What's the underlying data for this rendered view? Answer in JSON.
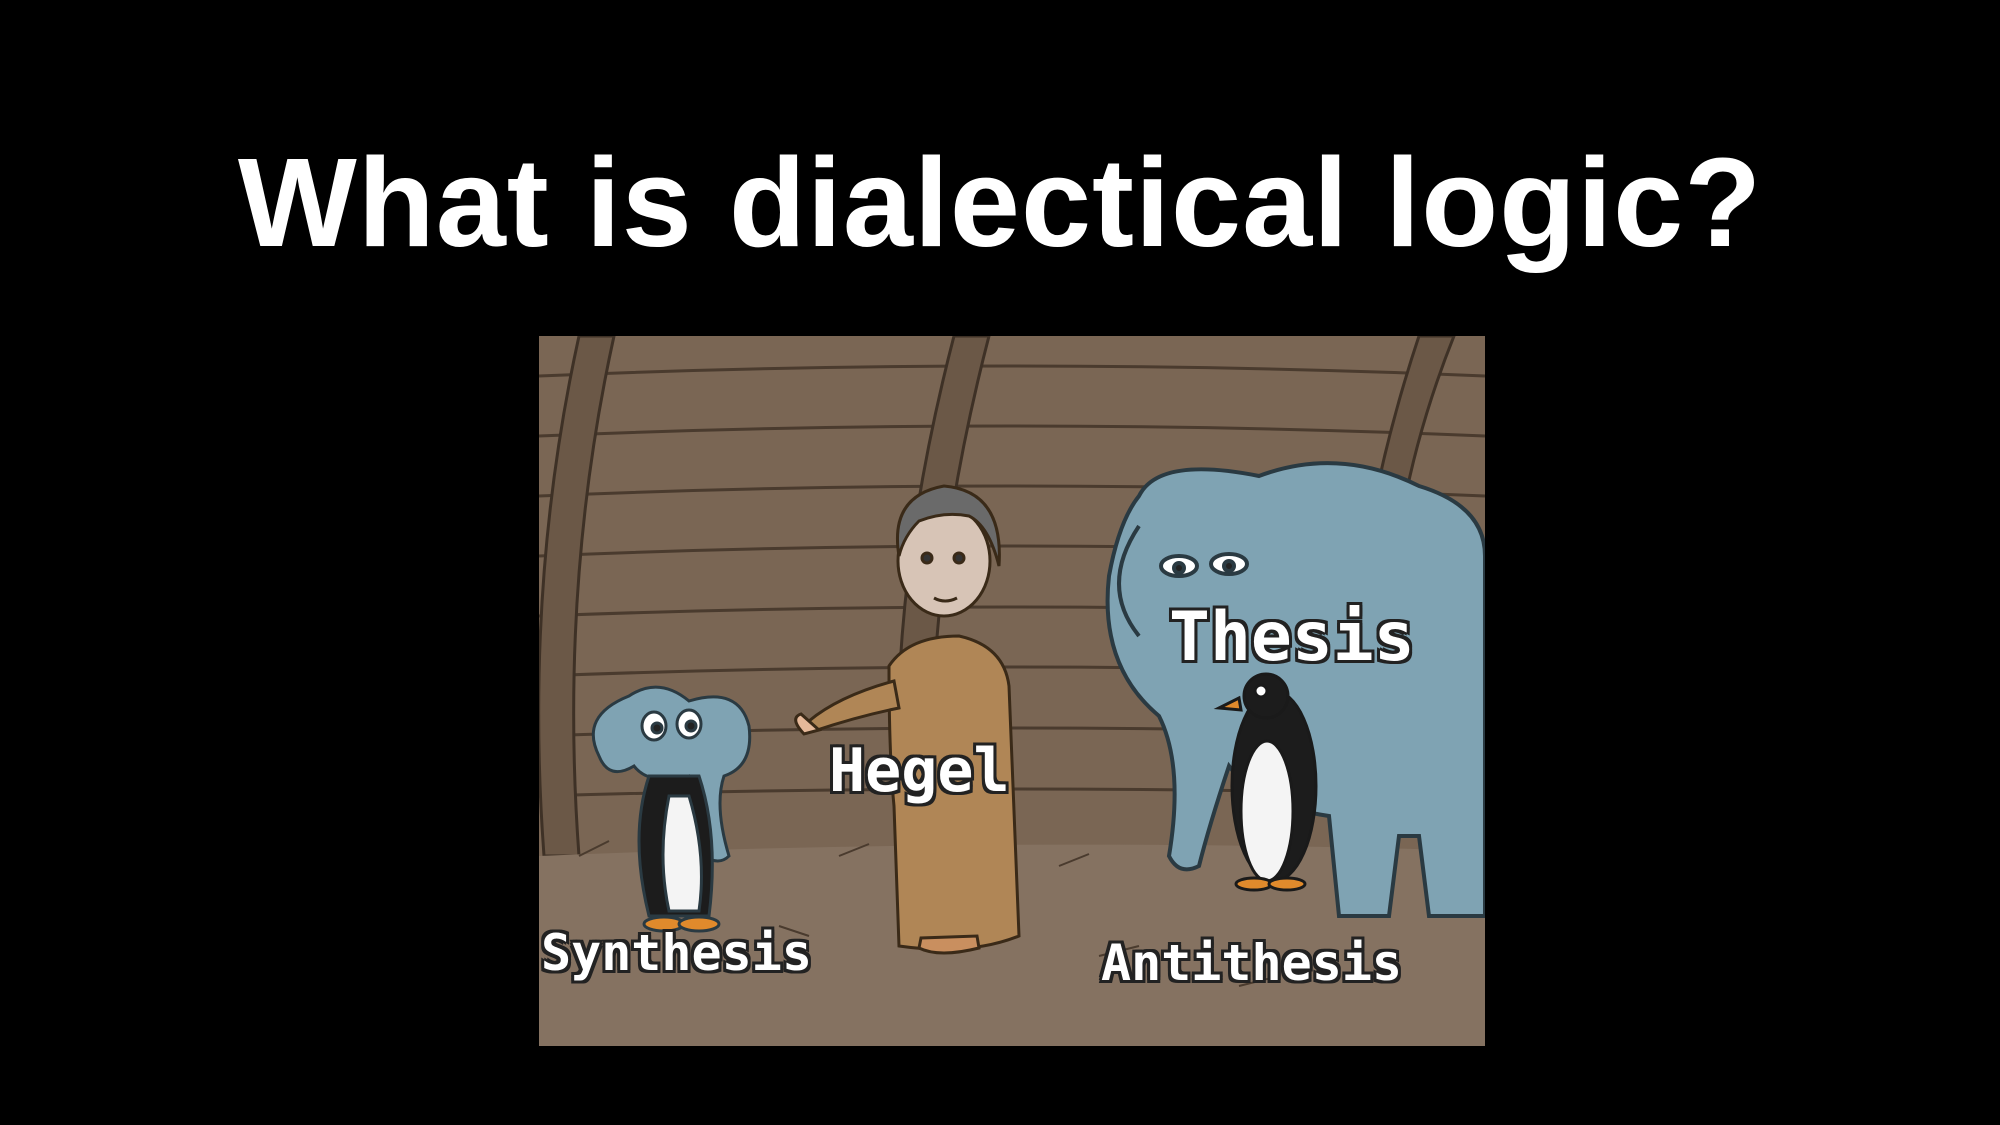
{
  "slide": {
    "title": "What is dialectical logic?"
  },
  "meme": {
    "labels": {
      "thesis": "Thesis",
      "hegel": "Hegel",
      "synthesis": "Synthesis",
      "antithesis": "Antithesis"
    }
  },
  "colors": {
    "background": "#000000",
    "title": "#ffffff",
    "wood": "#7d6a58",
    "elephant": "#7fa3b3"
  }
}
